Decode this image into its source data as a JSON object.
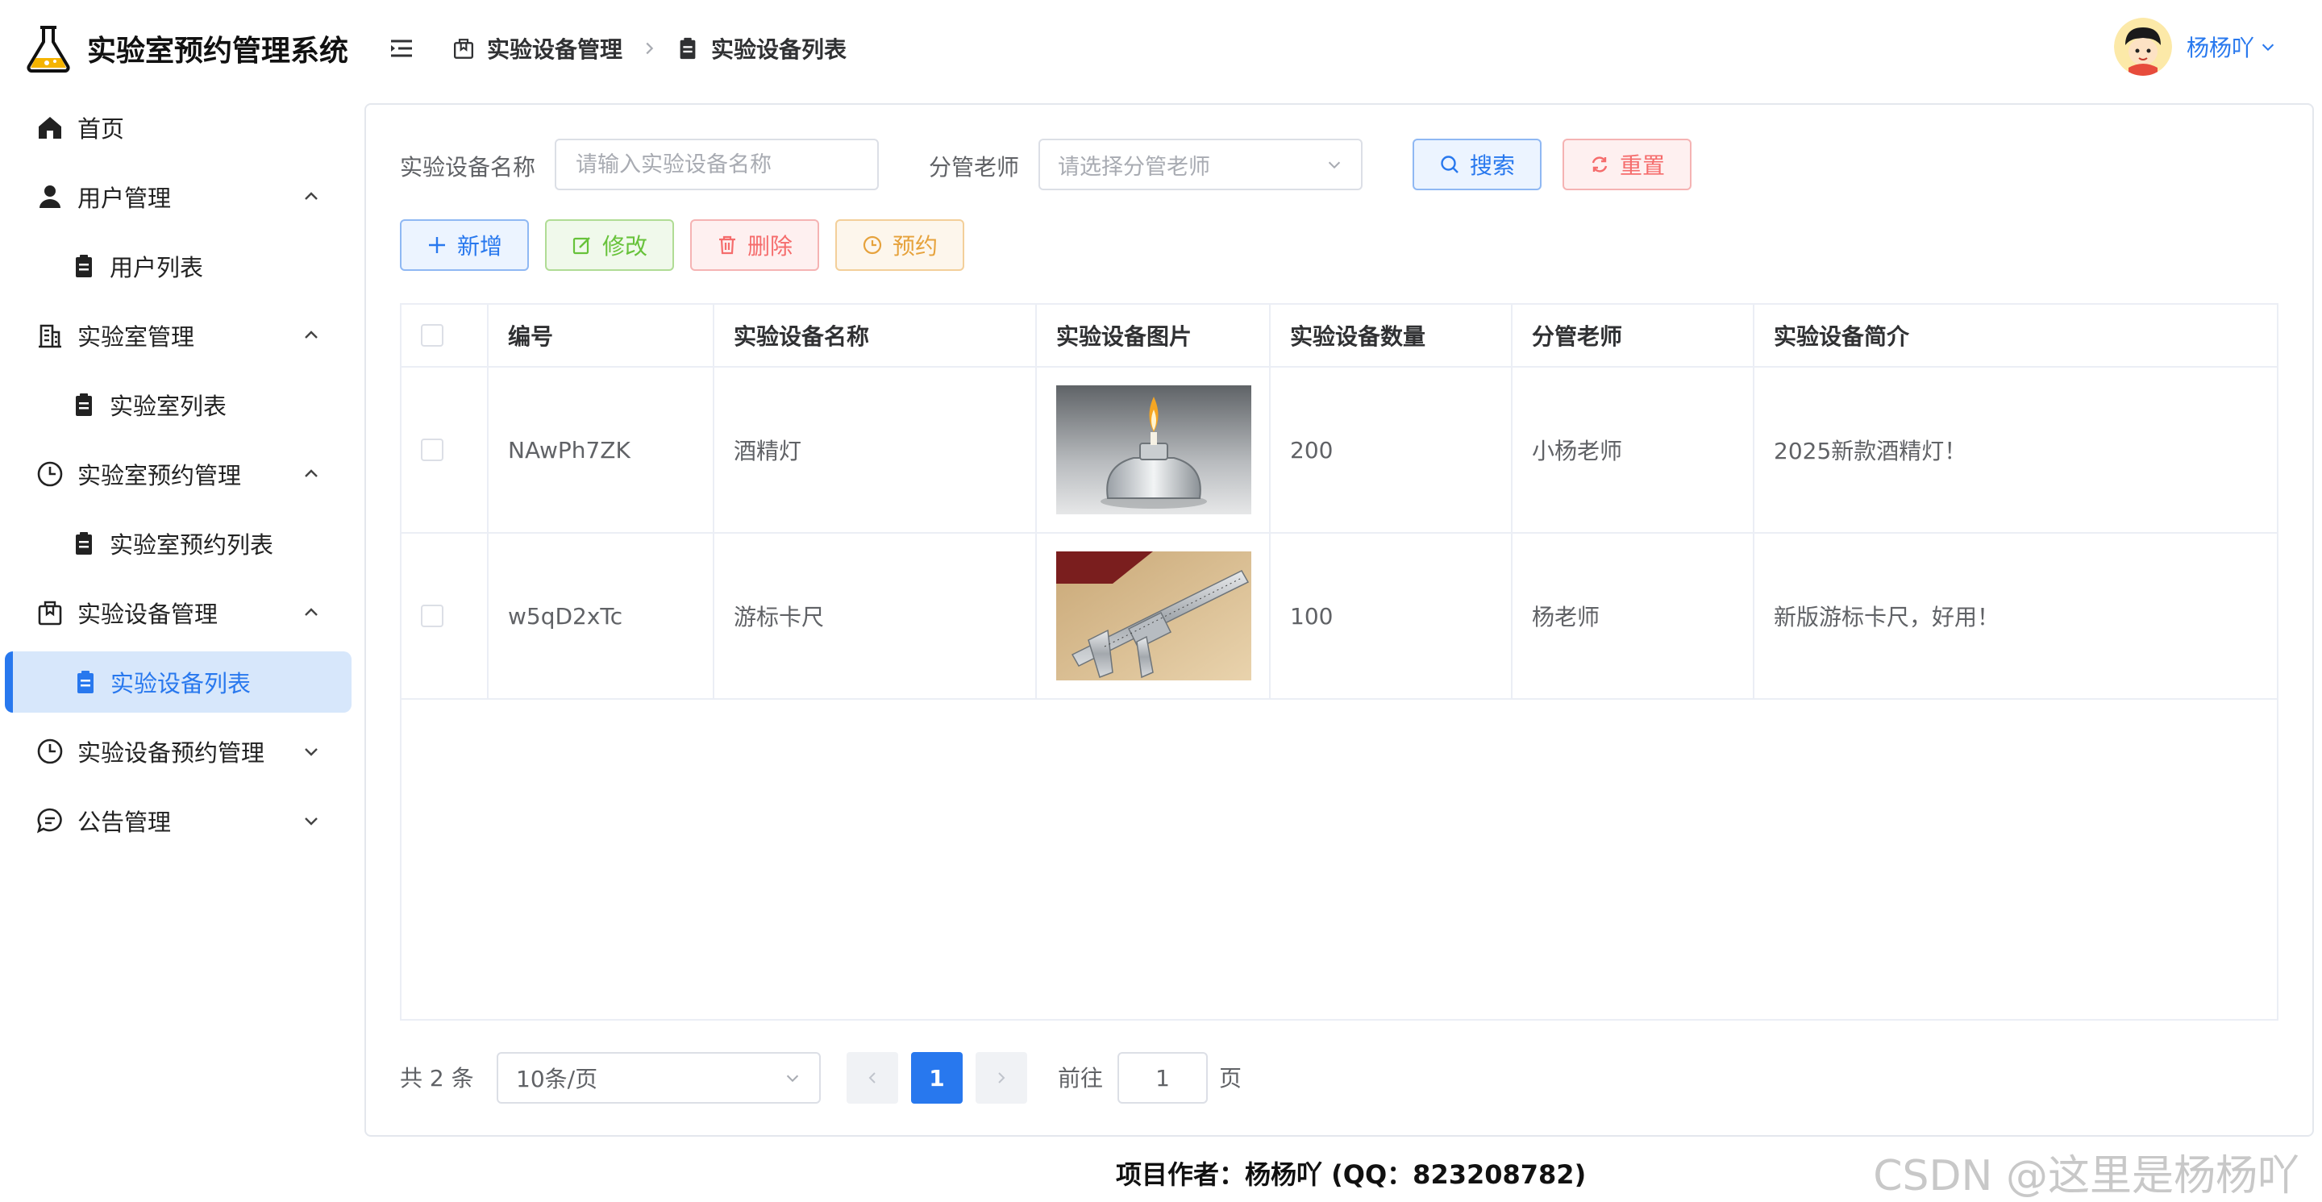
{
  "app": {
    "title": "实验室预约管理系统"
  },
  "sidebar": {
    "items": [
      {
        "label": "首页"
      },
      {
        "label": "用户管理"
      },
      {
        "label": "用户列表"
      },
      {
        "label": "实验室管理"
      },
      {
        "label": "实验室列表"
      },
      {
        "label": "实验室预约管理"
      },
      {
        "label": "实验室预约列表"
      },
      {
        "label": "实验设备管理"
      },
      {
        "label": "实验设备列表"
      },
      {
        "label": "实验设备预约管理"
      },
      {
        "label": "公告管理"
      }
    ],
    "active": "实验设备列表"
  },
  "header": {
    "breadcrumb": [
      "实验设备管理",
      "实验设备列表"
    ],
    "username": "杨杨吖"
  },
  "filters": {
    "name_label": "实验设备名称",
    "name_placeholder": "请输入实验设备名称",
    "teacher_label": "分管老师",
    "teacher_placeholder": "请选择分管老师",
    "search_label": "搜索",
    "reset_label": "重置"
  },
  "toolbar": {
    "add_label": "新增",
    "edit_label": "修改",
    "delete_label": "删除",
    "reserve_label": "预约"
  },
  "table": {
    "columns": [
      "编号",
      "实验设备名称",
      "实验设备图片",
      "实验设备数量",
      "分管老师",
      "实验设备简介"
    ],
    "rows": [
      {
        "id": "NAwPh7ZK",
        "name": "酒精灯",
        "image": "alcohol-lamp-photo",
        "quantity": "200",
        "teacher": "小杨老师",
        "intro": "2025新款酒精灯！"
      },
      {
        "id": "w5qD2xTc",
        "name": "游标卡尺",
        "image": "vernier-caliper-photo",
        "quantity": "100",
        "teacher": "杨老师",
        "intro": "新版游标卡尺，好用！"
      }
    ]
  },
  "pagination": {
    "total_text": "共 2 条",
    "page_size": "10条/页",
    "current_page": "1",
    "goto_label": "前往",
    "goto_value": "1",
    "page_unit": "页"
  },
  "footer": {
    "text": "项目作者：杨杨吖 (QQ：823208782)"
  },
  "watermark": "CSDN @这里是杨杨吖",
  "colors": {
    "primary": "#2878ee",
    "danger": "#f56c6c",
    "success": "#67c23a",
    "warning": "#e6a23c",
    "active_bg": "#d7e7fb"
  }
}
